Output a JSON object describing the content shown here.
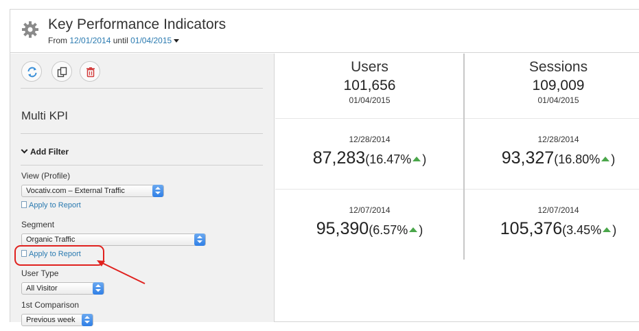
{
  "header": {
    "title": "Key Performance Indicators",
    "from_label": "From",
    "from_date": "12/01/2014",
    "until_label": "until",
    "until_date": "01/04/2015"
  },
  "toolbar": {
    "icons": [
      "refresh-icon",
      "copy-icon",
      "trash-icon"
    ]
  },
  "sidebar": {
    "kpi_name": "Multi KPI",
    "add_filter": "Add Filter",
    "view_label": "View (Profile)",
    "view_value": "Vocativ.com – External Traffic",
    "apply_label": "Apply to Report",
    "segment_label": "Segment",
    "segment_value": "Organic Traffic",
    "user_type_label": "User Type",
    "user_type_value": "All Visitor",
    "comparison_label": "1st Comparison",
    "comparison_value": "Previous week"
  },
  "metrics": [
    {
      "label": "Users",
      "value": "101,656",
      "date": "01/04/2015",
      "comparisons": [
        {
          "date": "12/28/2014",
          "value": "87,283",
          "pct": "16.47%"
        },
        {
          "date": "12/07/2014",
          "value": "95,390",
          "pct": "6.57%"
        }
      ]
    },
    {
      "label": "Sessions",
      "value": "109,009",
      "date": "01/04/2015",
      "comparisons": [
        {
          "date": "12/28/2014",
          "value": "93,327",
          "pct": "16.80%"
        },
        {
          "date": "12/07/2014",
          "value": "105,376",
          "pct": "3.45%"
        }
      ]
    }
  ],
  "colors": {
    "link": "#2a7ab0",
    "up_arrow": "#4aa64a",
    "highlight": "#e0211e",
    "select_accent": "#2f7fe6"
  }
}
